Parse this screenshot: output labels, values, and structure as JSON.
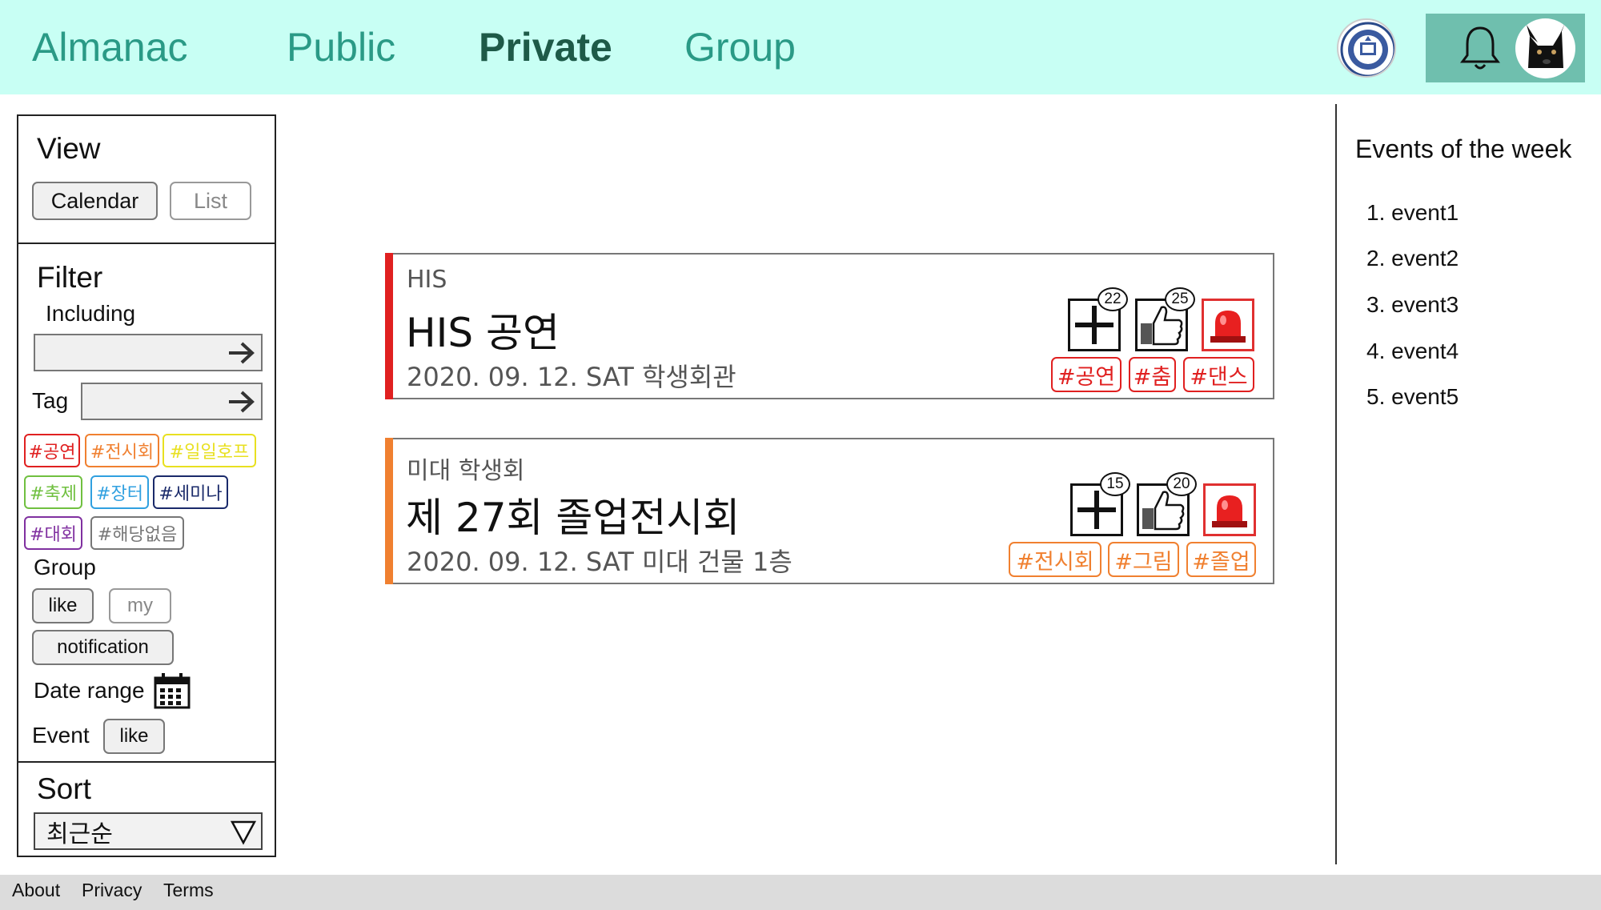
{
  "header": {
    "nav": [
      {
        "label": "Almanac"
      },
      {
        "label": "Public"
      },
      {
        "label": "Private",
        "active": true
      },
      {
        "label": "Group"
      }
    ]
  },
  "sidebar": {
    "view": {
      "title": "View",
      "calendar_label": "Calendar",
      "list_label": "List"
    },
    "filter": {
      "title": "Filter",
      "including_label": "Including",
      "including_value": "",
      "tag_label": "Tag",
      "tag_value": "",
      "tags": [
        {
          "label": "#공연",
          "color": "#e02020"
        },
        {
          "label": "#전시회",
          "color": "#f08030"
        },
        {
          "label": "#일일호프",
          "color": "#e8e020"
        },
        {
          "label": "#축제",
          "color": "#70c040"
        },
        {
          "label": "#장터",
          "color": "#30a0e0"
        },
        {
          "label": "#세미나",
          "color": "#1a2a6a"
        },
        {
          "label": "#대회",
          "color": "#8030a0"
        },
        {
          "label": "#해당없음",
          "color": "#777777"
        }
      ],
      "group_label": "Group",
      "group_like": "like",
      "group_my": "my",
      "group_notification": "notification",
      "date_range_label": "Date range",
      "event_label": "Event",
      "event_like": "like"
    },
    "sort": {
      "title": "Sort",
      "selected": "최근순"
    }
  },
  "events": [
    {
      "org": "HIS",
      "title": "HIS 공연",
      "meta": "2020. 09. 12. SAT  학생회관",
      "accent": "#e02020",
      "add_count": "22",
      "like_count": "25",
      "tags": [
        "#공연",
        "#춤",
        "#댄스"
      ],
      "tag_color": "#e02020"
    },
    {
      "org": "미대 학생회",
      "title": "제 27회 졸업전시회",
      "meta": "2020. 09. 12. SAT  미대 건물 1층",
      "accent": "#f08030",
      "add_count": "15",
      "like_count": "20",
      "tags": [
        "#전시회",
        "#그림",
        "#졸업"
      ],
      "tag_color": "#f08030"
    }
  ],
  "week": {
    "title": "Events of the week",
    "items": [
      "1. event1",
      "2. event2",
      "3. event3",
      "4. event4",
      "5. event5"
    ]
  },
  "footer": {
    "links": [
      "About",
      "Privacy",
      "Terms"
    ]
  },
  "colors": {
    "header_bg": "#c8fff4",
    "nav_color": "#2a9a86",
    "user_box": "#6fbfae"
  }
}
